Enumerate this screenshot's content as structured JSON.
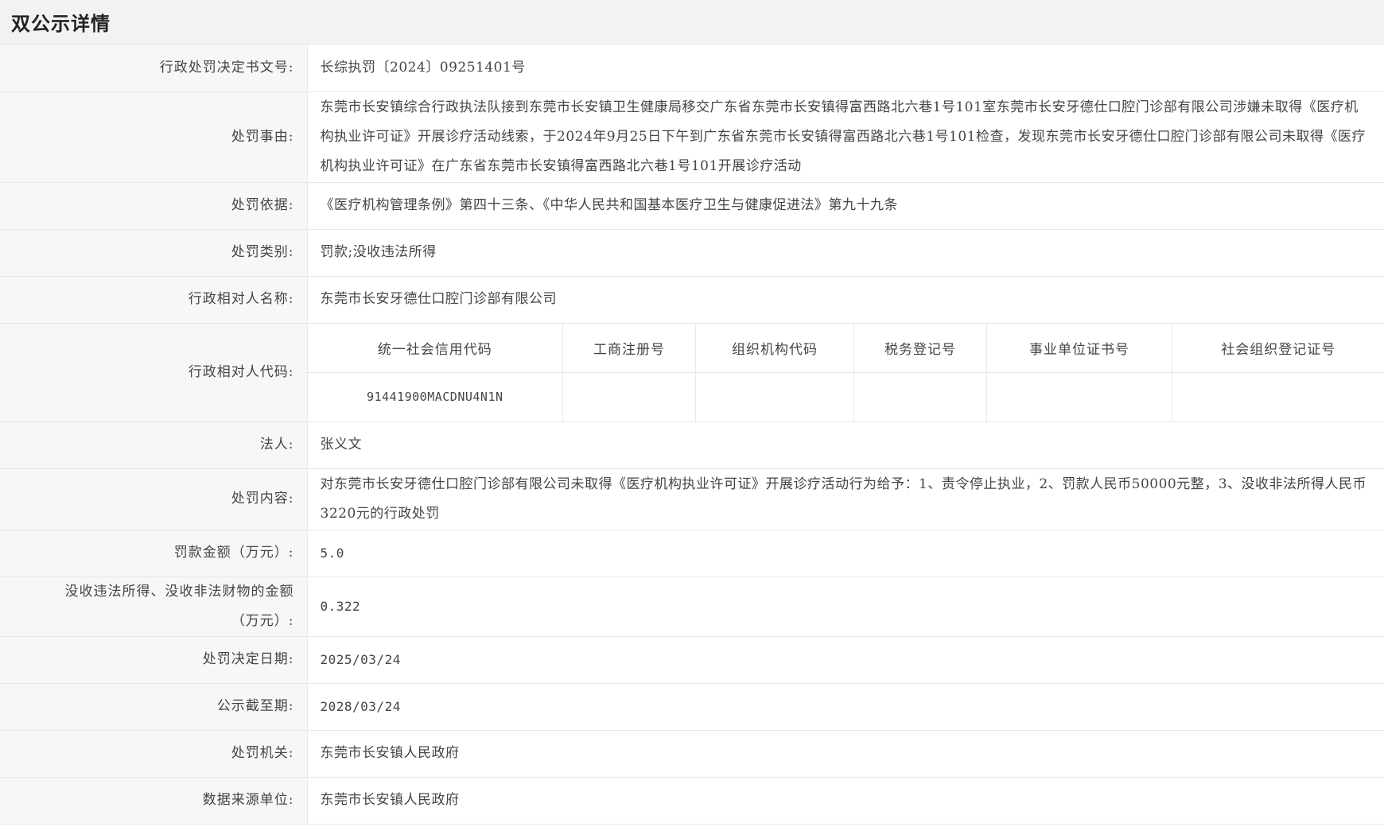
{
  "header": {
    "title": "双公示详情"
  },
  "fields": {
    "decision_no": {
      "label": "行政处罚决定书文号:",
      "value": "长综执罚〔2024〕09251401号"
    },
    "reason": {
      "label": "处罚事由:",
      "value": "东莞市长安镇综合行政执法队接到东莞市长安镇卫生健康局移交广东省东莞市长安镇得富西路北六巷1号101室东莞市长安牙德仕口腔门诊部有限公司涉嫌未取得《医疗机构执业许可证》开展诊疗活动线索，于2024年9月25日下午到广东省东莞市长安镇得富西路北六巷1号101检查，发现东莞市长安牙德仕口腔门诊部有限公司未取得《医疗机构执业许可证》在广东省东莞市长安镇得富西路北六巷1号101开展诊疗活动"
    },
    "basis": {
      "label": "处罚依据:",
      "value": "《医疗机构管理条例》第四十三条、《中华人民共和国基本医疗卫生与健康促进法》第九十九条"
    },
    "category": {
      "label": "处罚类别:",
      "value": "罚款;没收违法所得"
    },
    "party_name": {
      "label": "行政相对人名称:",
      "value": "东莞市长安牙德仕口腔门诊部有限公司"
    },
    "party_code": {
      "label": "行政相对人代码:",
      "columns": [
        "统一社会信用代码",
        "工商注册号",
        "组织机构代码",
        "税务登记号",
        "事业单位证书号",
        "社会组织登记证号"
      ],
      "values": [
        "91441900MACDNU4N1N",
        "",
        "",
        "",
        "",
        ""
      ]
    },
    "legal_person": {
      "label": "法人:",
      "value": "张义文"
    },
    "content": {
      "label": "处罚内容:",
      "value": "对东莞市长安牙德仕口腔门诊部有限公司未取得《医疗机构执业许可证》开展诊疗活动行为给予：1、责令停止执业，2、罚款人民币50000元整，3、没收非法所得人民币3220元的行政处罚"
    },
    "fine_amount": {
      "label": "罚款金额（万元）:",
      "value": "5.0"
    },
    "confiscation_amount": {
      "label": "没收违法所得、没收非法财物的金额（万元）:",
      "value": "0.322"
    },
    "decision_date": {
      "label": "处罚决定日期:",
      "value": "2025/03/24"
    },
    "publicity_deadline": {
      "label": "公示截至期:",
      "value": "2028/03/24"
    },
    "authority": {
      "label": "处罚机关:",
      "value": "东莞市长安镇人民政府"
    },
    "data_source": {
      "label": "数据来源单位:",
      "value": "东莞市长安镇人民政府"
    }
  }
}
